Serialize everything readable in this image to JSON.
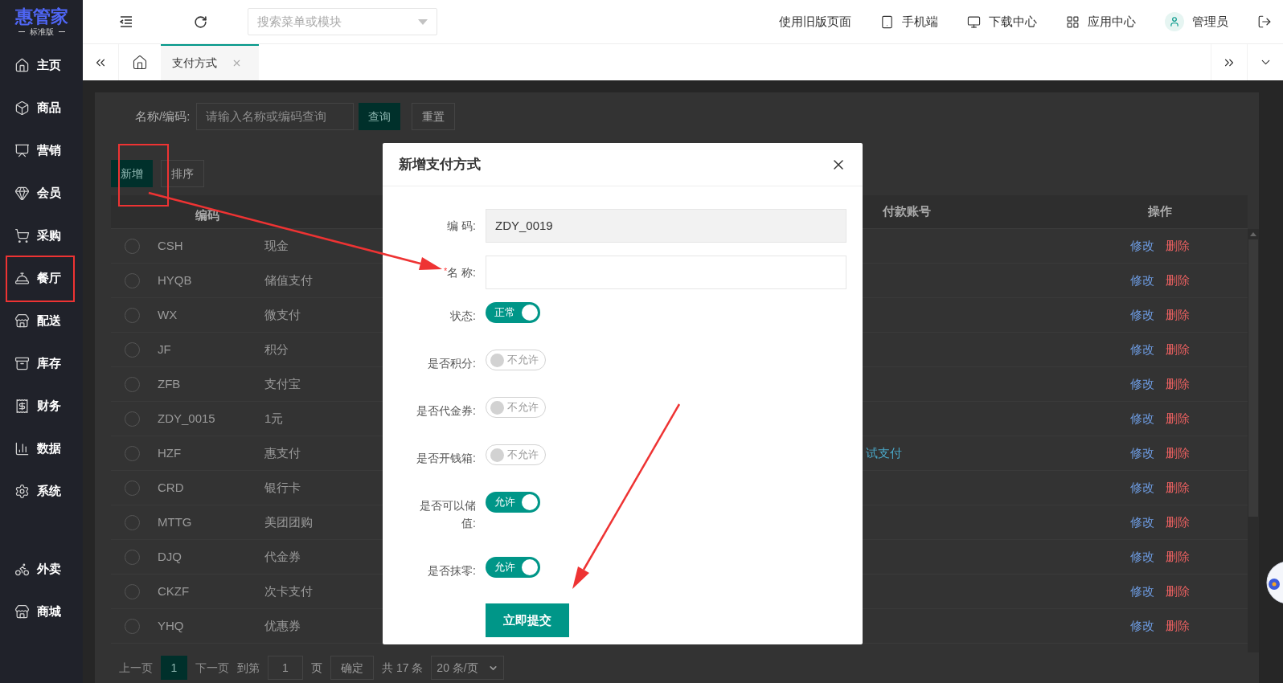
{
  "sidebar": {
    "logo": "惠管家",
    "edition": "标准版",
    "items": [
      {
        "label": "主页"
      },
      {
        "label": "商品"
      },
      {
        "label": "营销"
      },
      {
        "label": "会员"
      },
      {
        "label": "采购"
      },
      {
        "label": "餐厅"
      },
      {
        "label": "配送"
      },
      {
        "label": "库存"
      },
      {
        "label": "财务"
      },
      {
        "label": "数据"
      },
      {
        "label": "系统"
      }
    ],
    "extra_items": [
      {
        "label": "外卖"
      },
      {
        "label": "商城"
      }
    ]
  },
  "topbar": {
    "search_placeholder": "搜索菜单或模块",
    "old_version": "使用旧版页面",
    "links": [
      {
        "label": "手机端"
      },
      {
        "label": "下载中心"
      },
      {
        "label": "应用中心"
      },
      {
        "label": "管理员"
      }
    ]
  },
  "tabs": [
    {
      "label": "支付方式",
      "selected": true
    }
  ],
  "filter": {
    "label": "名称/编码:",
    "placeholder": "请输入名称或编码查询",
    "search": "查询",
    "reset": "重置"
  },
  "toolbar": [
    "新增",
    "排序"
  ],
  "table": {
    "columns": {
      "code": "编码",
      "account": "付款账号",
      "actions": "操作"
    },
    "rows": [
      {
        "selected": false,
        "code": "CSH",
        "name": "现金",
        "actions": [
          "修改",
          "删除"
        ]
      },
      {
        "selected": false,
        "code": "HYQB",
        "name": "储值支付",
        "actions": [
          "修改",
          "删除"
        ]
      },
      {
        "selected": false,
        "code": "WX",
        "name": "微支付",
        "actions": [
          "修改",
          "删除"
        ]
      },
      {
        "selected": false,
        "code": "JF",
        "name": "积分",
        "actions": [
          "修改",
          "删除"
        ]
      },
      {
        "selected": false,
        "code": "ZFB",
        "name": "支付宝",
        "actions": [
          "修改",
          "删除"
        ]
      },
      {
        "selected": false,
        "code": "ZDY_0015",
        "name": "1元",
        "actions": [
          "修改",
          "删除"
        ]
      },
      {
        "selected": false,
        "code": "HZF",
        "name": "惠支付",
        "account": "试支付",
        "actions": [
          "修改",
          "删除"
        ]
      },
      {
        "selected": false,
        "code": "CRD",
        "name": "银行卡",
        "actions": [
          "修改",
          "删除"
        ]
      },
      {
        "selected": false,
        "code": "MTTG",
        "name": "美团团购",
        "actions": [
          "修改",
          "删除"
        ]
      },
      {
        "selected": false,
        "code": "DJQ",
        "name": "代金券",
        "actions": [
          "修改",
          "删除"
        ]
      },
      {
        "selected": false,
        "code": "CKZF",
        "name": "次卡支付",
        "actions": [
          "修改",
          "删除"
        ]
      },
      {
        "selected": false,
        "code": "YHQ",
        "name": "优惠券",
        "actions": [
          "修改",
          "删除"
        ]
      }
    ]
  },
  "pagination": {
    "prev": "上一页",
    "pages": [
      {
        "label": "1",
        "selected": true
      }
    ],
    "next": "下一页",
    "goto": "到第",
    "page_input": "1",
    "page_unit": "页",
    "confirm": "确定",
    "total": "共 17 条",
    "page_size": "20 条/页"
  },
  "modal": {
    "title": "新增支付方式",
    "fields": [
      {
        "kind": "text",
        "label": "编 码:",
        "value": "ZDY_0019",
        "disabled": true
      },
      {
        "kind": "text",
        "label": "名 称:",
        "required": true,
        "required_mark": "*",
        "disabled": false
      },
      {
        "kind": "switch",
        "label": "状态:",
        "on": true,
        "text": "正常"
      },
      {
        "kind": "switch",
        "label": "是否积分:",
        "on": false,
        "text": "不允许"
      },
      {
        "kind": "switch",
        "label": "是否代金券:",
        "on": false,
        "text": "不允许"
      },
      {
        "kind": "switch",
        "label": "是否开钱箱:",
        "on": false,
        "text": "不允许"
      },
      {
        "kind": "switch",
        "label": "是否可以储值:",
        "on": true,
        "text": "允许"
      },
      {
        "kind": "switch",
        "label": "是否抹零:",
        "on": true,
        "text": "允许"
      }
    ],
    "submit": "立即提交"
  }
}
